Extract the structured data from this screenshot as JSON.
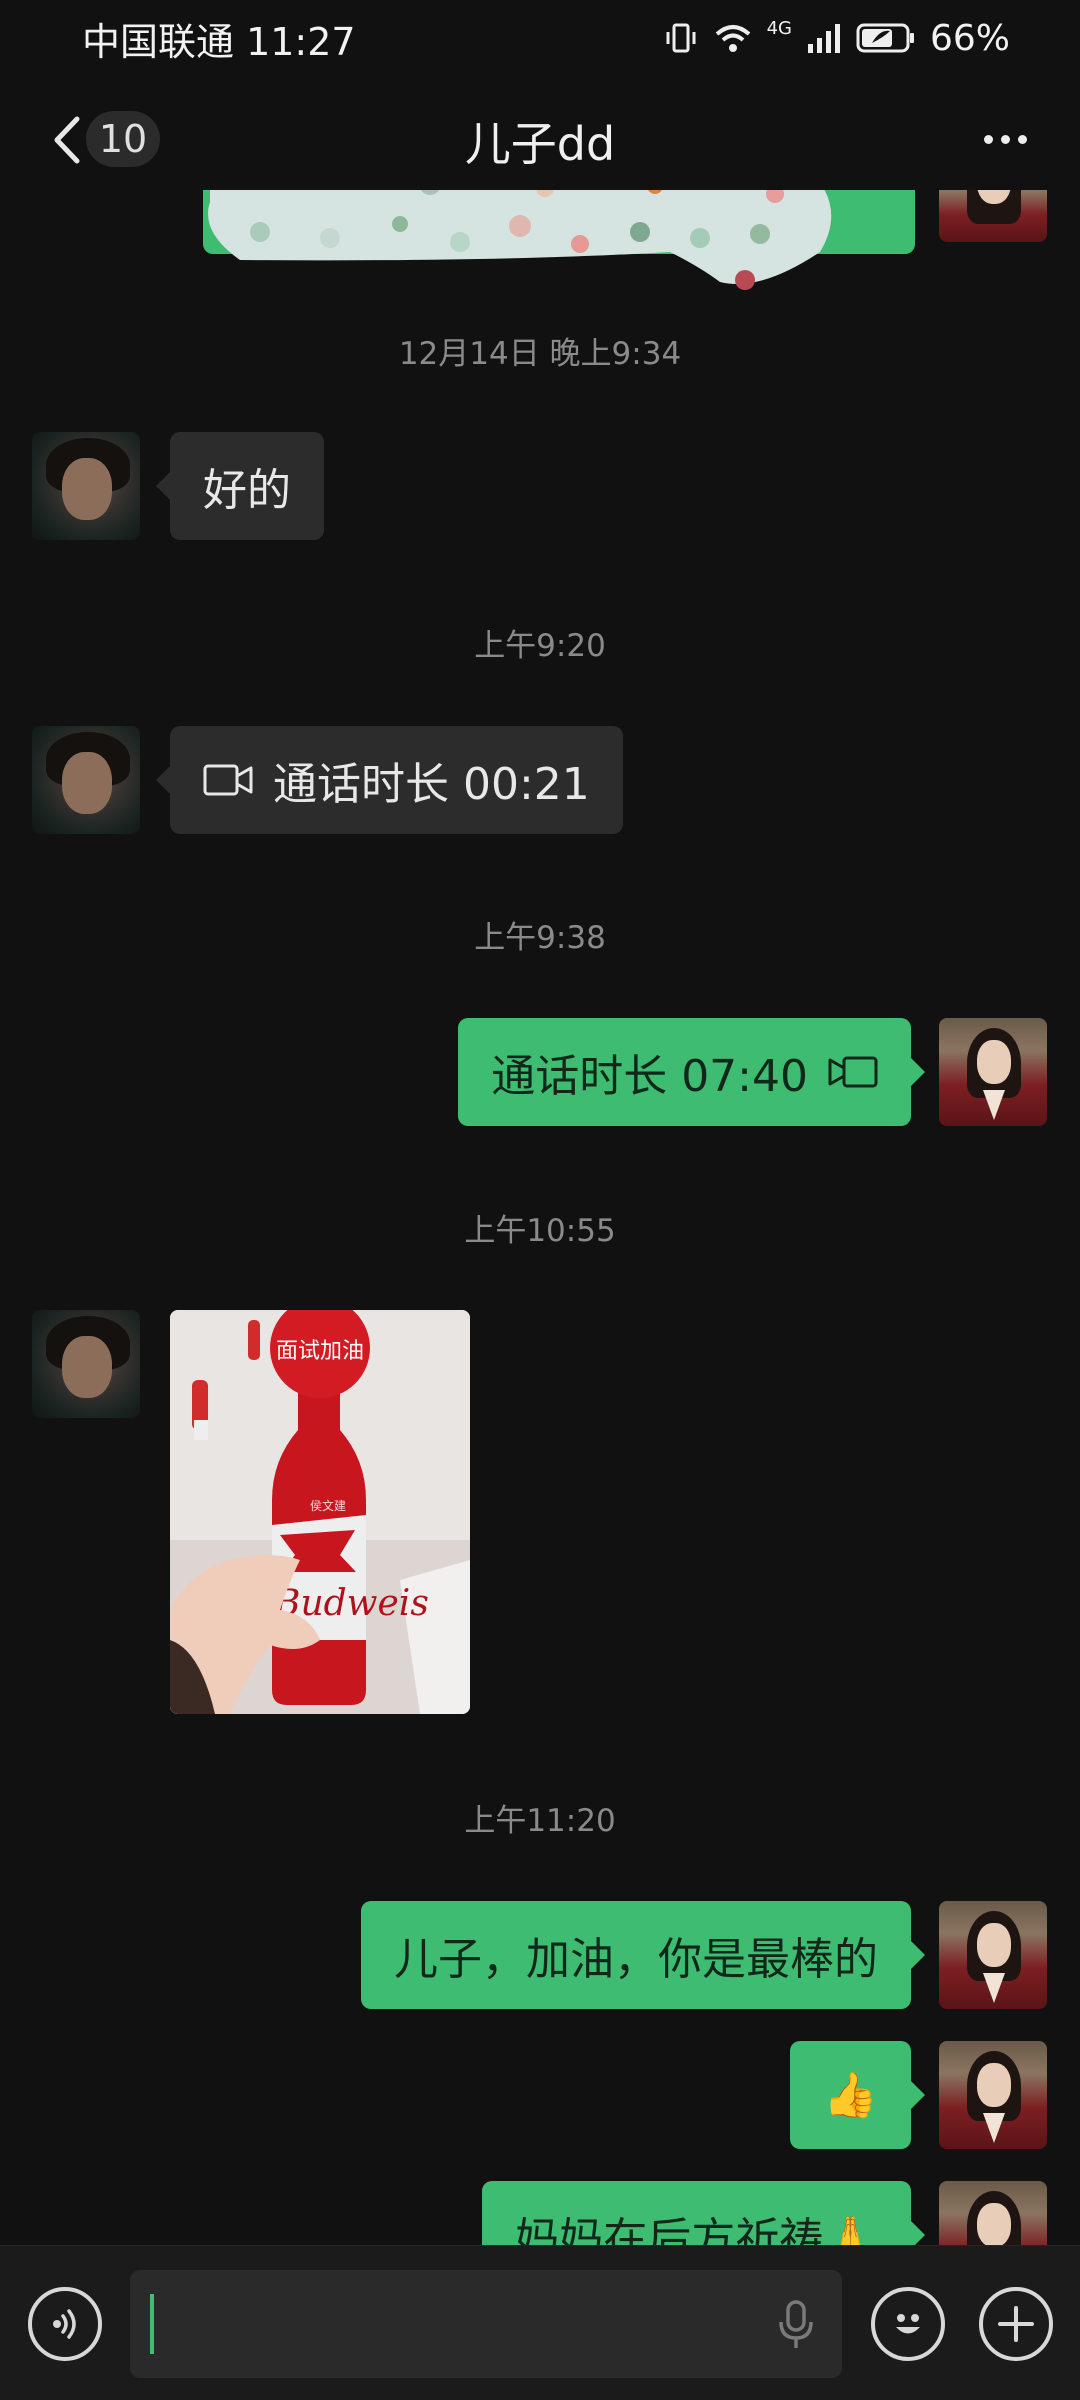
{
  "status_bar": {
    "carrier_time": "中国联通 11:27",
    "network": "4G",
    "battery": "66%"
  },
  "header": {
    "unread_count": "10",
    "title": "儿子dd"
  },
  "messages": {
    "ts1": "12月14日 晚上9:34",
    "msg1": "好的",
    "ts2": "上午9:20",
    "msg2": "通话时长 00:21",
    "ts3": "上午9:38",
    "msg3": "通话时长 07:40",
    "ts4": "上午10:55",
    "ts5": "上午11:20",
    "msg5": "儿子，加油，你是最棒的",
    "msg6": "👍",
    "msg7": "妈妈在后方祈祷🙏"
  },
  "photo": {
    "badge_text": "面试加油",
    "brand_text": "Budweis",
    "name_text": "侯文建"
  },
  "icons": {
    "back": "chevron-left-icon",
    "more": "more-dots-icon",
    "voice": "voice-mode-icon",
    "mic": "mic-icon",
    "emoji": "emoji-icon",
    "plus": "plus-icon",
    "call": "video-call-icon"
  },
  "colors": {
    "background": "#111111",
    "outgoing_bubble": "#3ebc71",
    "incoming_bubble": "#2c2c2c"
  }
}
